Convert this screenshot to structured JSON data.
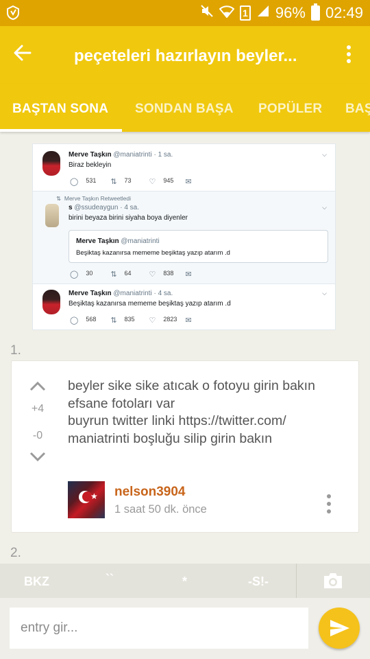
{
  "status_bar": {
    "battery": "96%",
    "time": "02:49",
    "sim": "1"
  },
  "app_bar": {
    "title": "peçeteleri hazırlayın beyler..."
  },
  "tabs": [
    {
      "label": "BAŞTAN SONA",
      "active": true
    },
    {
      "label": "SONDAN BAŞA",
      "active": false
    },
    {
      "label": "POPÜLER",
      "active": false
    },
    {
      "label": "BAŞ",
      "active": false
    }
  ],
  "tweet_screenshot": {
    "tweet1": {
      "name": "Merve Taşkın",
      "handle": "@maniatrinti · 1 sa.",
      "text": "Biraz bekleyin",
      "replies": "531",
      "retweets": "73",
      "likes": "945"
    },
    "retweet_label": "Merve Taşkın Retweetledi",
    "tweet2": {
      "name": "s",
      "handle": "@ssudeaygun · 4 sa.",
      "text": "birini beyaza birini siyaha boya diyenler",
      "replies": "30",
      "retweets": "64",
      "likes": "838",
      "quote": {
        "name": "Merve Taşkın",
        "handle": "@maniatrinti",
        "text": "Beşiktaş kazanırsa mememe beşiktaş yazıp atarım .d"
      }
    },
    "tweet3": {
      "name": "Merve Taşkın",
      "handle": "@maniatrinti · 4 sa.",
      "text": "Beşiktaş kazanırsa mememe beşiktaş yazıp atarım .d",
      "replies": "568",
      "retweets": "835",
      "likes": "2823"
    }
  },
  "entries": [
    {
      "number": "1.",
      "score_up": "+4",
      "score_down": "-0",
      "text": "beyler sike sike atıcak o fotoyu girin bakın efsane fotoları var\nbuyrun twitter linki https://twitter.com/\nmaniatrinti boşluğu silip girin bakın",
      "author": "nelson3904",
      "time": "1 saat 50 dk. önce"
    },
    {
      "number": "2."
    }
  ],
  "format_toolbar": {
    "bkz": "BKZ",
    "backtick": "``",
    "star": "*",
    "spoiler": "-S!-"
  },
  "composer": {
    "placeholder": "entry gir..."
  },
  "colors": {
    "accent": "#f0c80e",
    "status_bar": "#dfa400",
    "author": "#c8651b",
    "send": "#f5c21b"
  }
}
